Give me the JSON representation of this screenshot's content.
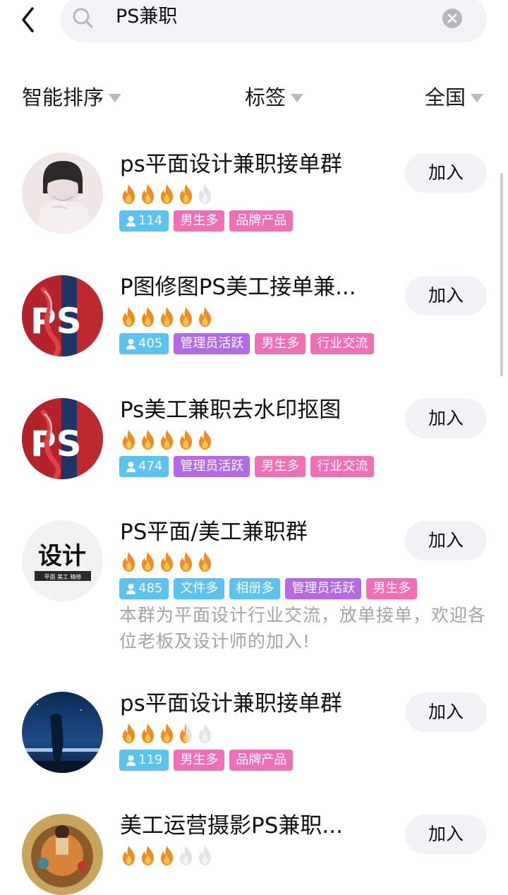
{
  "search": {
    "query": "PS兼职"
  },
  "filters": {
    "sort": "智能排序",
    "tag": "标签",
    "region": "全国"
  },
  "join_label": "加入",
  "colors": {
    "count_tag": "#5bc3ef",
    "male_tag": "#f06fb4",
    "brand_tag": "#f06fb4",
    "admin_tag": "#b36ae6",
    "industry_tag": "#f06fb4",
    "file_tag": "#5bc3ef",
    "album_tag": "#5bc3ef",
    "flame_active": "#f28a1e",
    "flame_inactive": "#e1e3e7"
  },
  "groups": [
    {
      "name": "ps平面设计兼职接单群",
      "activity_level": 4,
      "count": "114",
      "tags": [
        "男生多",
        "品牌产品"
      ],
      "avatar": "person-photo-avatar",
      "join": "加入"
    },
    {
      "name": "P图修图PS美工接单兼...",
      "activity_level": 5,
      "count": "405",
      "tags": [
        "管理员活跃",
        "男生多",
        "行业交流"
      ],
      "avatar": "ps-logo-avatar",
      "join": "加入"
    },
    {
      "name": "Ps美工兼职去水印抠图",
      "activity_level": 5,
      "count": "474",
      "tags": [
        "管理员活跃",
        "男生多",
        "行业交流"
      ],
      "avatar": "ps-logo-avatar",
      "join": "加入"
    },
    {
      "name": "PS平面/美工兼职群",
      "activity_level": 5,
      "count": "485",
      "tags": [
        "文件多",
        "相册多",
        "管理员活跃",
        "男生多"
      ],
      "description": "本群为平面设计行业交流，放单接单，欢迎各位老板及设计师的加入!",
      "avatar": "design-logo-avatar",
      "avatar_text": "设计",
      "avatar_subtext": "平面 美工 精修",
      "join": "加入"
    },
    {
      "name": "ps平面设计兼职接单群",
      "activity_level": 3.5,
      "count": "119",
      "tags": [
        "男生多",
        "品牌产品"
      ],
      "avatar": "night-sky-avatar",
      "join": "加入"
    },
    {
      "name": "美工运营摄影PS兼职...",
      "activity_level": 3,
      "count": "",
      "tags": [],
      "avatar": "colorful-photo-avatar",
      "join": "加入"
    }
  ]
}
